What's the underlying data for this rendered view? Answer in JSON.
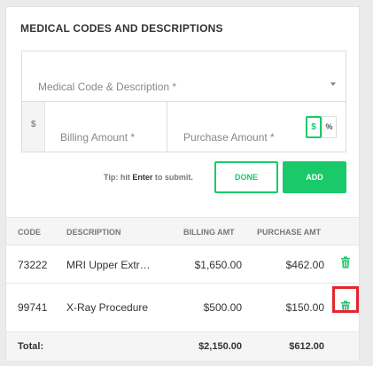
{
  "section": {
    "title": "MEDICAL CODES AND DESCRIPTIONS"
  },
  "form": {
    "code_placeholder": "Medical Code & Description  *",
    "currency_prefix": "$",
    "billing_placeholder": "Billing Amount  *",
    "purchase_placeholder": "Purchase Amount  *",
    "toggle_dollar": "$",
    "toggle_percent": "%",
    "tip_prefix": "Tip: hit ",
    "tip_key": "Enter",
    "tip_suffix": " to submit.",
    "done_label": "DONE",
    "add_label": "ADD"
  },
  "table": {
    "headers": {
      "code": "CODE",
      "description": "DESCRIPTION",
      "billing": "BILLING AMT",
      "purchase": "PURCHASE AMT"
    },
    "rows": [
      {
        "code": "73222",
        "description": "MRI Upper Extr…",
        "billing": "$1,650.00",
        "purchase": "$462.00"
      },
      {
        "code": "99741",
        "description": "X-Ray Procedure",
        "billing": "$500.00",
        "purchase": "$150.00"
      }
    ],
    "total": {
      "label": "Total:",
      "billing": "$2,150.00",
      "purchase": "$612.00"
    }
  },
  "colors": {
    "accent": "#1ac96a",
    "highlight": "#e3262f"
  },
  "icons": {
    "delete": "trash-icon",
    "dropdown": "chevron-down-icon"
  }
}
